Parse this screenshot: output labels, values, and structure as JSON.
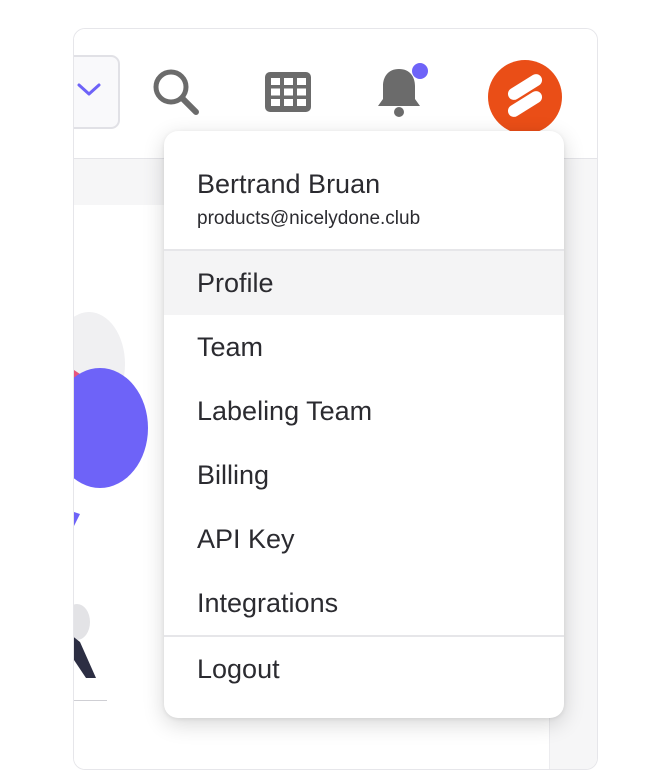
{
  "header": {
    "notification_dot_color": "#6e63f8",
    "avatar_color": "#ea4e17"
  },
  "account_menu": {
    "user": {
      "name": "Bertrand Bruan",
      "email": "products@nicelydone.club"
    },
    "items": [
      {
        "label": "Profile",
        "active": true
      },
      {
        "label": "Team"
      },
      {
        "label": "Labeling Team"
      },
      {
        "label": "Billing"
      },
      {
        "label": "API Key"
      },
      {
        "label": "Integrations"
      }
    ],
    "logout_label": "Logout"
  },
  "colors": {
    "accent": "#6e63f8",
    "brand": "#ea4e17",
    "text": "#2b2b30",
    "icon": "#6b6b6b"
  }
}
